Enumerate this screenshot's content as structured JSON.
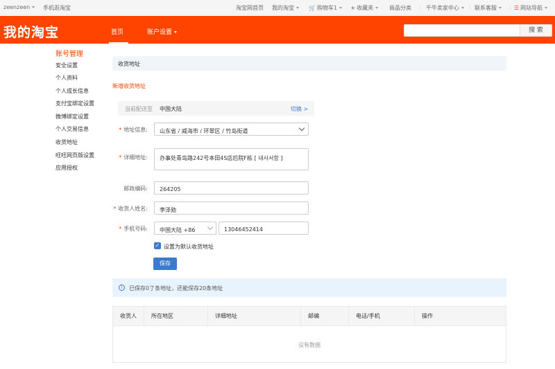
{
  "topbar": {
    "user": "zeenzeen",
    "mobile": "手机逛淘宝",
    "home": "淘宝网首页",
    "my_taobao": "我的淘宝",
    "cart": "购物车1",
    "favorites": "收藏夹",
    "categories": "商品分类",
    "seller_center": "千牛卖家中心",
    "support": "联系客服",
    "site_nav": "网站导航"
  },
  "header": {
    "logo": "我的淘宝",
    "nav_home": "首页",
    "nav_account": "账户设置",
    "search_placeholder": "",
    "search_button": "搜 索"
  },
  "sidebar": {
    "title": "账号管理",
    "items": [
      {
        "label": "安全设置"
      },
      {
        "label": "个人资料"
      },
      {
        "label": "个人成长信息"
      },
      {
        "label": "支付宝绑定设置"
      },
      {
        "label": "微博绑定设置"
      },
      {
        "label": "个人交易信息"
      },
      {
        "label": "收货地址"
      },
      {
        "label": "旺旺网页版设置"
      },
      {
        "label": "应用授权"
      }
    ]
  },
  "main": {
    "section_title": "收货地址",
    "new_address": "新增收货地址",
    "region": {
      "label": "当前配送至",
      "value": "中国大陆",
      "switch": "切换 >"
    },
    "form": {
      "address_info_label": "地址信息:",
      "address_info_value": "山东省 / 威海市 / 环翠区 / 竹岛街道",
      "detail_label": "详细地址:",
      "detail_value": "办事处青岛路242号本田4S店后院F栋 [ 내사서함 ]",
      "postal_label": "邮政编码:",
      "postal_value": "264205",
      "name_label": "收货人姓名:",
      "name_value": "李泽勋",
      "phone_label": "手机号码:",
      "phone_region": "中国大陆 +86",
      "phone_value": "13046452414",
      "default_label": "设置为默认收货地址",
      "default_checked": true,
      "save_button": "保存"
    },
    "info": "已保存0了条地址，还能保存20条地址",
    "table": {
      "headers": [
        "收货人",
        "所在地区",
        "详细地址",
        "邮编",
        "电话/手机",
        "操作"
      ],
      "empty": "没有数据"
    }
  }
}
